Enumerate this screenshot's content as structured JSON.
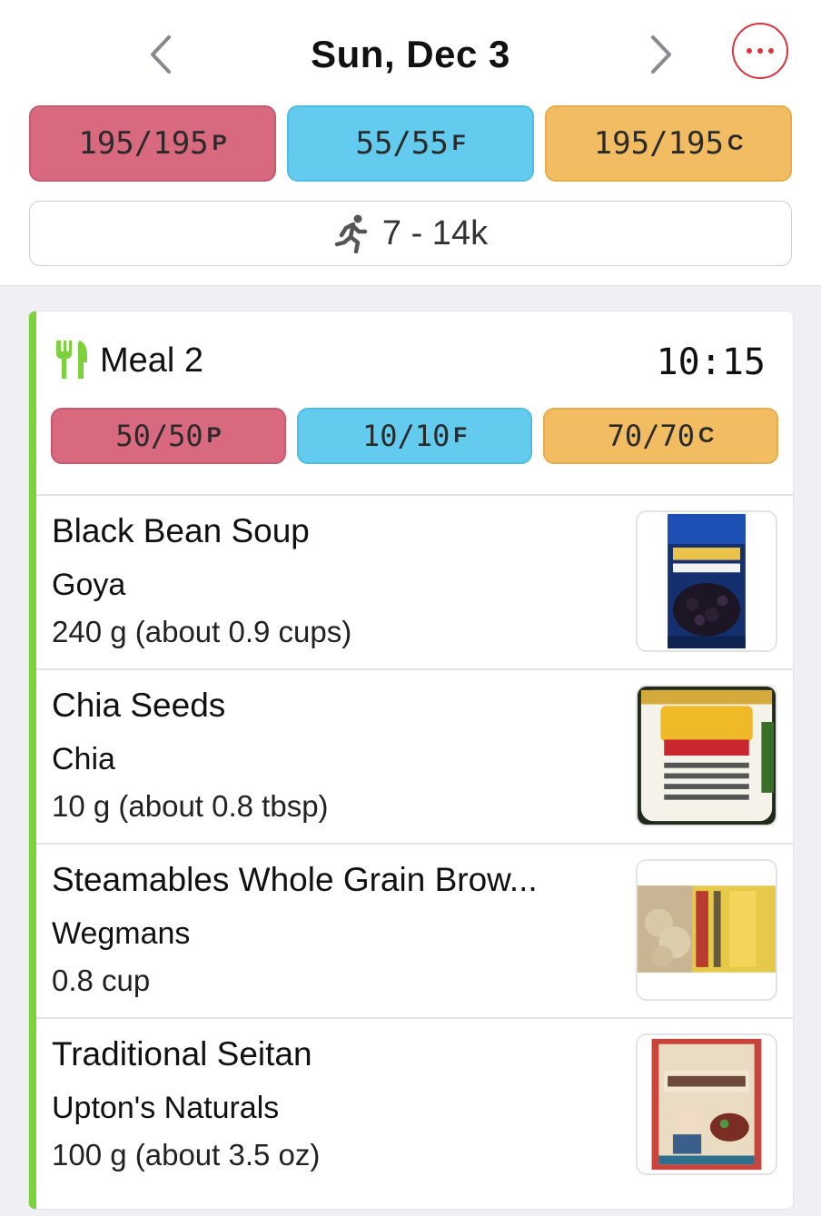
{
  "header": {
    "date": "Sun, Dec 3",
    "prev_icon": "chevron-left-icon",
    "next_icon": "chevron-right-icon",
    "more_icon": "ellipsis-icon"
  },
  "daily_macros": {
    "protein": {
      "value": "195/195",
      "unit": "P"
    },
    "fat": {
      "value": "55/55",
      "unit": "F"
    },
    "carbs": {
      "value": "195/195",
      "unit": "C"
    }
  },
  "steps": {
    "icon": "running-person-icon",
    "label": "7 - 14k"
  },
  "meal": {
    "icon": "fork-knife-icon",
    "title": "Meal 2",
    "time": "10:15",
    "macros": {
      "protein": {
        "value": "50/50",
        "unit": "P"
      },
      "fat": {
        "value": "10/10",
        "unit": "F"
      },
      "carbs": {
        "value": "70/70",
        "unit": "C"
      }
    },
    "items": [
      {
        "name": "Black Bean Soup",
        "brand": "Goya",
        "amount": "240 g (about 0.9 cups)",
        "image_icon": "black-bean-soup-can-image"
      },
      {
        "name": "Chia Seeds",
        "brand": "Chia",
        "amount": "10 g (about 0.8 tbsp)",
        "image_icon": "chia-seeds-jar-image"
      },
      {
        "name": "Steamables Whole Grain Brow...",
        "brand": "Wegmans",
        "amount": "0.8 cup",
        "image_icon": "brown-rice-bag-image"
      },
      {
        "name": "Traditional Seitan",
        "brand": "Upton's Naturals",
        "amount": "100 g (about 3.5 oz)",
        "image_icon": "seitan-package-image"
      }
    ]
  },
  "colors": {
    "protein": "#d9697f",
    "fat": "#63cbee",
    "carbs": "#f2bd62",
    "accent": "#7bd23a",
    "more_button": "#e0323b"
  }
}
